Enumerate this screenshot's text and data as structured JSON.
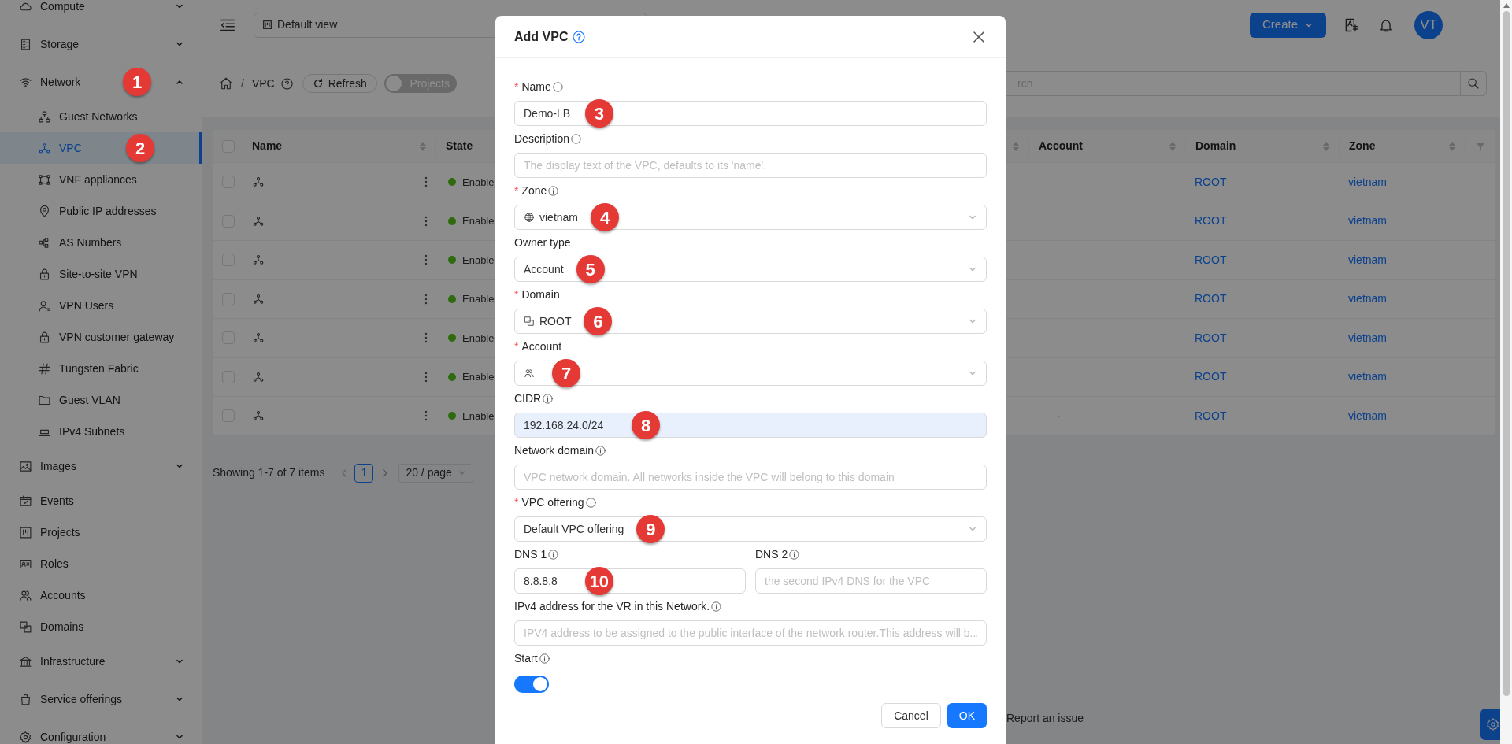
{
  "sidebar": {
    "items": [
      {
        "label": "Compute",
        "expanded": false,
        "selected": false
      },
      {
        "label": "Storage",
        "expanded": false,
        "selected": false
      },
      {
        "label": "Network",
        "expanded": true,
        "selected": false,
        "marker": "1",
        "children": [
          {
            "label": "Guest Networks",
            "selected": false
          },
          {
            "label": "VPC",
            "selected": true,
            "marker": "2"
          },
          {
            "label": "VNF appliances",
            "selected": false
          },
          {
            "label": "Public IP addresses",
            "selected": false
          },
          {
            "label": "AS Numbers",
            "selected": false
          },
          {
            "label": "Site-to-site VPN",
            "selected": false
          },
          {
            "label": "VPN Users",
            "selected": false
          },
          {
            "label": "VPN customer gateway",
            "selected": false
          },
          {
            "label": "Tungsten Fabric",
            "selected": false
          },
          {
            "label": "Guest VLAN",
            "selected": false
          },
          {
            "label": "IPv4 Subnets",
            "selected": false
          }
        ]
      },
      {
        "label": "Images",
        "expanded": false,
        "selected": false
      },
      {
        "label": "Events",
        "selected": false
      },
      {
        "label": "Projects",
        "selected": false
      },
      {
        "label": "Roles",
        "selected": false
      },
      {
        "label": "Accounts",
        "selected": false
      },
      {
        "label": "Domains",
        "selected": false
      },
      {
        "label": "Infrastructure",
        "expanded": false,
        "selected": false
      },
      {
        "label": "Service offerings",
        "expanded": false,
        "selected": false
      },
      {
        "label": "Configuration",
        "expanded": false,
        "selected": false
      }
    ]
  },
  "header": {
    "view_select": "Default view",
    "create_button": "Create",
    "avatar": "VT"
  },
  "toolbar": {
    "breadcrumb_separator": "/",
    "breadcrumb_current": "VPC",
    "refresh_button": "Refresh",
    "projects_toggle": {
      "label": "Projects",
      "on": false
    },
    "search": {
      "placeholder": "rch"
    }
  },
  "table": {
    "all_checked": false,
    "columns": [
      {
        "label": "Name"
      },
      {
        "label": "State"
      },
      {
        "label": "Account"
      },
      {
        "label": "Domain"
      },
      {
        "label": "Zone"
      }
    ],
    "rows": [
      {
        "checked": false,
        "state": "Enable",
        "domain": "ROOT",
        "zone": "vietnam"
      },
      {
        "checked": false,
        "state": "Enable",
        "domain": "ROOT",
        "zone": "vietnam"
      },
      {
        "checked": false,
        "state": "Enable",
        "domain": "ROOT",
        "zone": "vietnam"
      },
      {
        "checked": false,
        "state": "Enable",
        "domain": "ROOT",
        "zone": "vietnam"
      },
      {
        "checked": false,
        "state": "Enable",
        "domain": "ROOT",
        "zone": "vietnam"
      },
      {
        "checked": false,
        "state": "Enable",
        "domain": "ROOT",
        "zone": "vietnam"
      },
      {
        "checked": false,
        "state": "Enable",
        "account": "-",
        "domain": "ROOT",
        "zone": "vietnam"
      }
    ]
  },
  "pagination": {
    "summary": "Showing 1-7 of 7 items",
    "pages": [
      {
        "label": "1",
        "selected": true
      }
    ],
    "page_size": "20 / page"
  },
  "footer": {
    "report_link": "Report an issue"
  },
  "modal": {
    "title": "Add VPC",
    "fields": [
      {
        "kind": "input",
        "required_mark": "*",
        "label": "Name",
        "info": true,
        "value": "Demo-LB",
        "marker": "3"
      },
      {
        "kind": "input",
        "label": "Description",
        "info": true,
        "placeholder": "The display text of the VPC, defaults to its 'name'."
      },
      {
        "kind": "select",
        "required_mark": "*",
        "label": "Zone",
        "info": true,
        "value": "vietnam",
        "marker": "4"
      },
      {
        "kind": "select",
        "label": "Owner type",
        "info": false,
        "value": "Account",
        "marker": "5"
      },
      {
        "kind": "select",
        "required_mark": "*",
        "label": "Domain",
        "info": false,
        "value": "ROOT",
        "marker": "6"
      },
      {
        "kind": "select",
        "required_mark": "*",
        "label": "Account",
        "info": false,
        "marker": "7"
      },
      {
        "kind": "input",
        "label": "CIDR",
        "info": true,
        "value": "192.168.24.0/24",
        "autofilled": true,
        "marker": "8"
      },
      {
        "kind": "input",
        "label": "Network domain",
        "info": true,
        "placeholder": "VPC network domain. All networks inside the VPC will belong to this domain"
      },
      {
        "kind": "select",
        "required_mark": "*",
        "label": "VPC offering",
        "info": true,
        "value": "Default VPC offering",
        "marker": "9"
      },
      {
        "kind": "pair",
        "fields": [
          {
            "kind": "input",
            "label": "DNS 1",
            "info": true,
            "value": "8.8.8.8",
            "marker": "10"
          },
          {
            "kind": "input",
            "label": "DNS 2",
            "info": true,
            "placeholder": "the second IPv4 DNS for the VPC"
          }
        ]
      },
      {
        "kind": "input",
        "label": "IPv4 address for the VR in this Network.",
        "info": true,
        "placeholder": "IPV4 address to be assigned to the public interface of the network router.This address will b..."
      },
      {
        "kind": "toggle",
        "label": "Start",
        "info": true,
        "on": true
      }
    ],
    "buttons": [
      {
        "label": "Cancel",
        "kind": "default"
      },
      {
        "label": "OK",
        "kind": "primary"
      }
    ]
  }
}
